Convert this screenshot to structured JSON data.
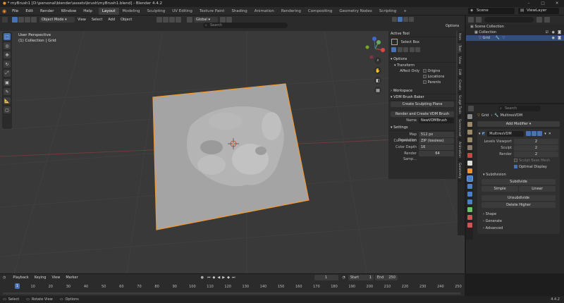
{
  "window": {
    "title": "* myBrush1 [D:\\personal\\blender\\assets\\brush\\myBrush1.blend] - Blender 4.4.2"
  },
  "menus": [
    "File",
    "Edit",
    "Render",
    "Window",
    "Help"
  ],
  "workspaces": [
    "Layout",
    "Modeling",
    "Sculpting",
    "UV Editing",
    "Texture Paint",
    "Shading",
    "Animation",
    "Rendering",
    "Compositing",
    "Geometry Nodes",
    "Scripting"
  ],
  "active_workspace": "Layout",
  "scene": "Scene",
  "view_layer": "ViewLayer",
  "viewport_header": {
    "mode": "Object Mode",
    "menus": [
      "View",
      "Select",
      "Add",
      "Object"
    ],
    "orientation": "Global",
    "search_placeholder": "Search",
    "options": "Options"
  },
  "viewport": {
    "line1": "User Perspective",
    "line2": "(1) Collection | Grid",
    "accent": "#f09a35"
  },
  "npanel": {
    "active_tool_header": "Active Tool",
    "select_box": "Select Box",
    "options_header": "Options",
    "transform_header": "Transform",
    "affect_only": "Affect Only",
    "origins": "Origins",
    "locations": "Locations",
    "parents": "Parents",
    "workspace_header": "Workspace",
    "vdm_header": "VDM Brush Baker",
    "create_planes": "Create Sculpting Plane",
    "render_create": "Render and Create VDM Brush",
    "name_label": "Name",
    "name_value": "NewVDMBrush",
    "settings_header": "Settings",
    "map_resolution_label": "Map Resolution",
    "map_resolution_value": "512 px",
    "compression_label": "Compression",
    "compression_value": "ZIP (lossless)",
    "color_depth_label": "Color Depth",
    "color_depth_value": "16",
    "render_samples_label": "Render Samp...",
    "render_samples_value": "64"
  },
  "vtabs": [
    "Item",
    "Tool",
    "View",
    "Edit",
    "Create",
    "Sculpt Tools",
    "Screencast",
    "Animation",
    "Geometry"
  ],
  "outliner": {
    "search_placeholder": "",
    "rows": [
      "Scene Collection",
      "Collection",
      "Grid"
    ]
  },
  "properties": {
    "search_placeholder": "Search",
    "breadcrumb_object": "Grid",
    "breadcrumb_modifier": "MultiresVDM",
    "add_modifier": "Add Modifier",
    "modifier_name": "MultiresVDM",
    "levels_viewport_label": "Levels Viewport",
    "levels_viewport_value": "2",
    "sculpt_label": "Sculpt",
    "sculpt_value": "2",
    "render_label": "Render",
    "render_value": "2",
    "sculpt_base_mesh": "Sculpt Base Mesh",
    "optimal_display": "Optimal Display",
    "subdivision_header": "Subdivision",
    "subdivide": "Subdivide",
    "simple": "Simple",
    "linear": "Linear",
    "unsubdivide": "Unsubdivide",
    "delete_higher": "Delete Higher",
    "shape": "Shape",
    "generate": "Generate",
    "advanced": "Advanced"
  },
  "timeline": {
    "menus": [
      "Playback",
      "Keying",
      "View",
      "Marker"
    ],
    "current_frame": "1",
    "start_label": "Start",
    "start_value": "1",
    "end_label": "End",
    "end_value": "250",
    "ticks": [
      "1",
      "10",
      "20",
      "30",
      "40",
      "50",
      "60",
      "70",
      "80",
      "90",
      "100",
      "110",
      "120",
      "130",
      "140",
      "150",
      "160",
      "170",
      "180",
      "190",
      "200",
      "210",
      "220",
      "230",
      "240",
      "250"
    ]
  },
  "statusbar": {
    "select": "Select",
    "rotate_view": "Rotate View",
    "options": "Options",
    "version": "4.4.2"
  }
}
